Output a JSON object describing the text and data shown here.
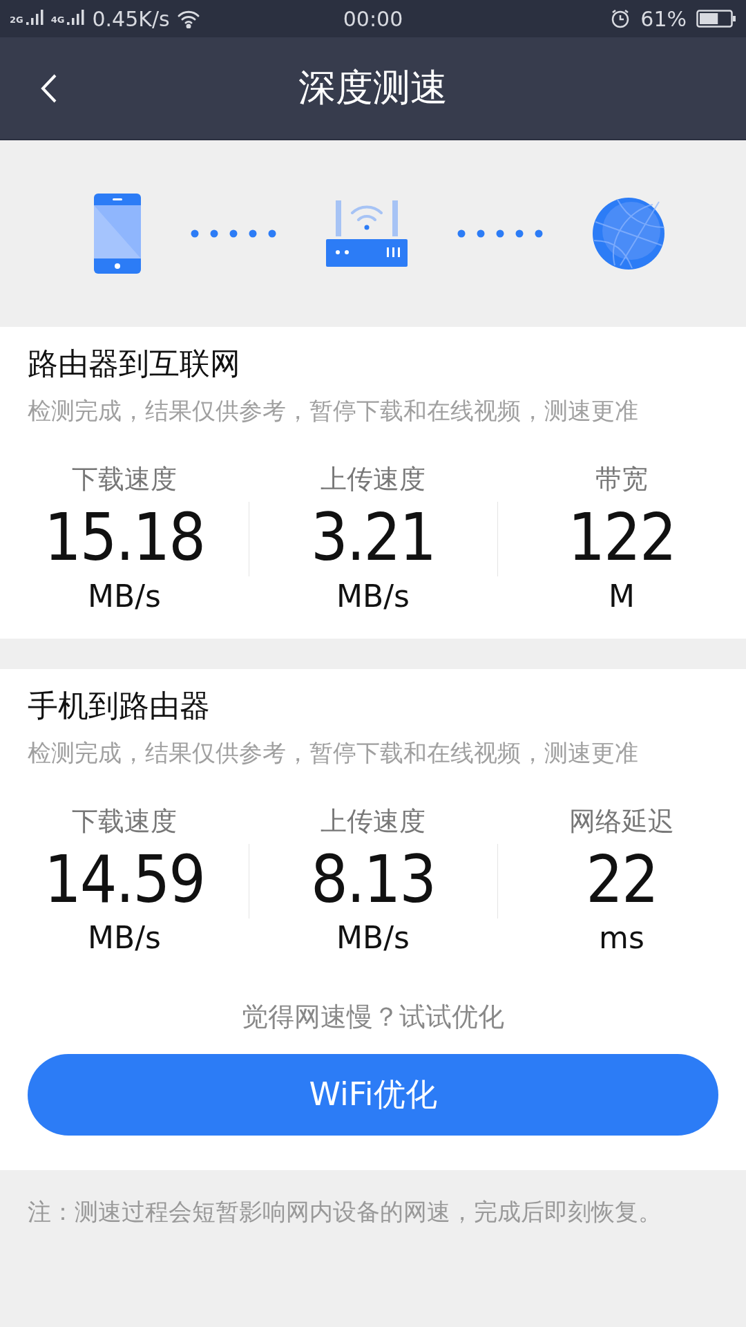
{
  "status_bar": {
    "networks": [
      "2G",
      "4G"
    ],
    "speed": "0.45K/s",
    "time": "00:00",
    "battery": {
      "text": "61%",
      "level": 0.61
    }
  },
  "header": {
    "title": "深度测速"
  },
  "sections": [
    {
      "title": "路由器到互联网",
      "subtitle": "检测完成，结果仅供参考，暂停下载和在线视频，测速更准",
      "metrics": [
        {
          "label": "下载速度",
          "value": "15.18",
          "unit": "MB/s"
        },
        {
          "label": "上传速度",
          "value": "3.21",
          "unit": "MB/s"
        },
        {
          "label": "带宽",
          "value": "122",
          "unit": "M"
        }
      ]
    },
    {
      "title": "手机到路由器",
      "subtitle": "检测完成，结果仅供参考，暂停下载和在线视频，测速更准",
      "metrics": [
        {
          "label": "下载速度",
          "value": "14.59",
          "unit": "MB/s"
        },
        {
          "label": "上传速度",
          "value": "8.13",
          "unit": "MB/s"
        },
        {
          "label": "网络延迟",
          "value": "22",
          "unit": "ms"
        }
      ],
      "prompt": "觉得网速慢？试试优化",
      "button": "WiFi优化"
    }
  ],
  "note": "注：测速过程会短暂影响网内设备的网速，完成后即刻恢复。"
}
